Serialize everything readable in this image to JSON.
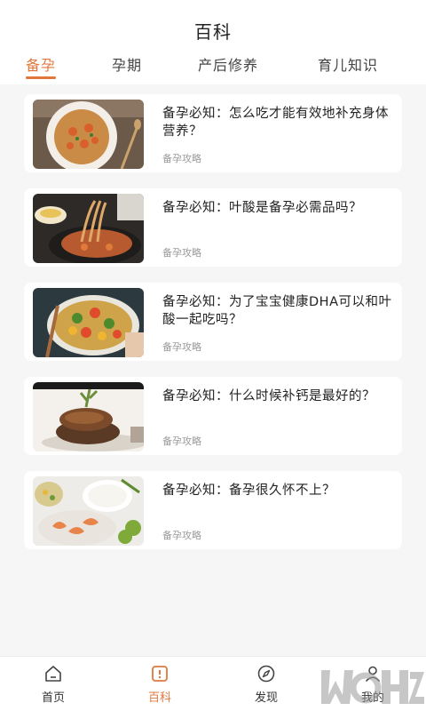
{
  "header": {
    "title": "百科"
  },
  "tabs": [
    {
      "label": "备孕",
      "active": true
    },
    {
      "label": "孕期",
      "active": false
    },
    {
      "label": "产后修养",
      "active": false
    },
    {
      "label": "育儿知识",
      "active": false
    }
  ],
  "articles": [
    {
      "title": "备孕必知：怎么吃才能有效地补充身体营养？",
      "tag": "备孕攻略",
      "image": "shrimp-pasta"
    },
    {
      "title": "备孕必知：叶酸是备孕必需品吗？",
      "tag": "备孕攻略",
      "image": "noodles"
    },
    {
      "title": "备孕必知：为了宝宝健康DHA可以和叶酸一起吃吗？",
      "tag": "备孕攻略",
      "image": "vegetable-salad"
    },
    {
      "title": "备孕必知：什么时候补钙是最好的？",
      "tag": "备孕攻略",
      "image": "steak"
    },
    {
      "title": "备孕必知：备孕很久怀不上？",
      "tag": "备孕攻略",
      "image": "shrimp-rice"
    }
  ],
  "bottom_nav": [
    {
      "label": "首页",
      "icon": "home-icon",
      "active": false
    },
    {
      "label": "百科",
      "icon": "book-icon",
      "active": true
    },
    {
      "label": "发现",
      "icon": "compass-icon",
      "active": false
    },
    {
      "label": "我的",
      "icon": "user-icon",
      "active": false
    }
  ],
  "colors": {
    "accent": "#e0773e",
    "background": "#f6f6f6",
    "tag": "#9a9a9a"
  }
}
